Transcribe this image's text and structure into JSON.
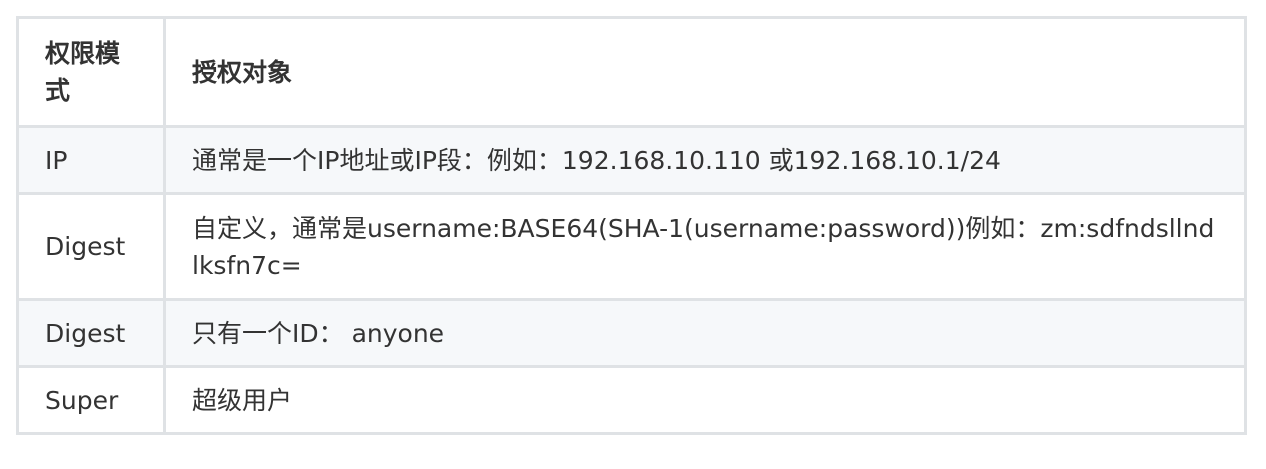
{
  "table": {
    "headers": {
      "mode": "权限模式",
      "object": "授权对象"
    },
    "rows": [
      {
        "mode": "IP",
        "object": "通常是一个IP地址或IP段：例如：192.168.10.110 或192.168.10.1/24"
      },
      {
        "mode": "Digest",
        "object": "自定义，通常是username:BASE64(SHA-1(username:password))例如：zm:sdfndsllndlksfn7c="
      },
      {
        "mode": "Digest",
        "object": "只有一个ID： anyone"
      },
      {
        "mode": "Super",
        "object": "超级用户"
      }
    ]
  }
}
